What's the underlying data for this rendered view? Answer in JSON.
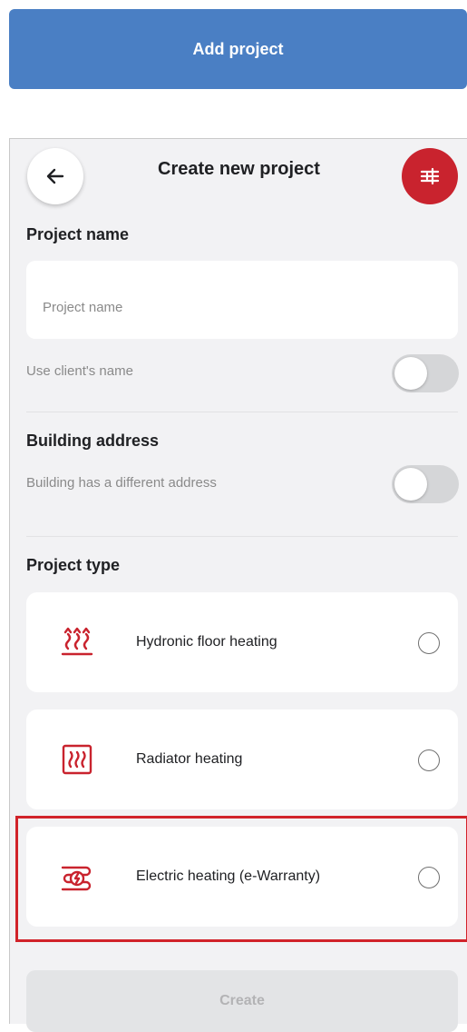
{
  "top_button": {
    "label": "Add project"
  },
  "header": {
    "title": "Create new project",
    "back_icon": "arrow-left-icon",
    "filter_icon": "sliders-icon",
    "accent_color": "#c9232e"
  },
  "project_name": {
    "section_title": "Project name",
    "placeholder": "Project name",
    "value": "",
    "use_client_name_label": "Use client's name",
    "use_client_name_on": false
  },
  "building_address": {
    "section_title": "Building address",
    "different_address_label": "Building has a different address",
    "different_address_on": false
  },
  "project_type": {
    "section_title": "Project type",
    "options": [
      {
        "label": "Hydronic floor heating",
        "icon": "floor-heating-icon",
        "selected": false
      },
      {
        "label": "Radiator heating",
        "icon": "radiator-icon",
        "selected": false
      },
      {
        "label": "Electric heating (e-Warranty)",
        "icon": "electric-heating-icon",
        "selected": false
      }
    ]
  },
  "create_button": {
    "label": "Create",
    "enabled": false
  },
  "colors": {
    "primary_blue": "#4a7fc4",
    "accent_red": "#c9232e",
    "highlight_red": "#d1232a"
  }
}
